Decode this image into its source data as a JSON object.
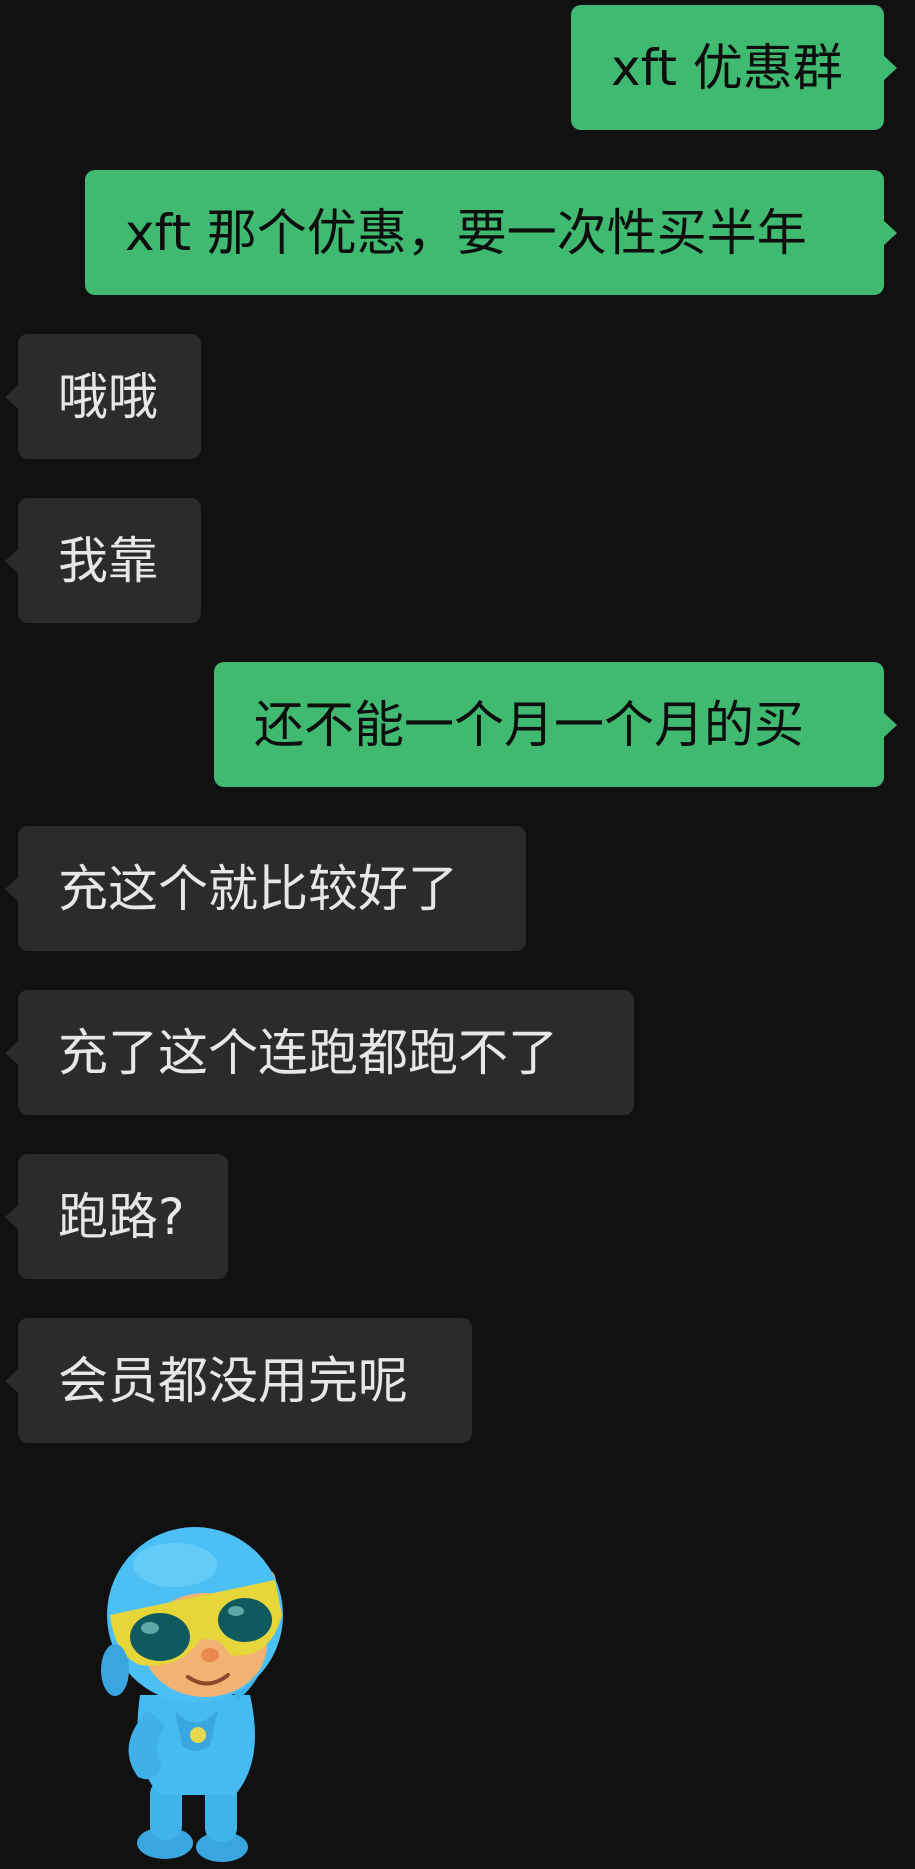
{
  "colors": {
    "background": "#111111",
    "outgoing_bubble": "#3fba70",
    "incoming_bubble": "#2b2b2b",
    "outgoing_text": "#0d0d0d",
    "incoming_text": "#e7e7e7"
  },
  "messages": [
    {
      "direction": "out",
      "text": "xft 优惠群"
    },
    {
      "direction": "out",
      "text": "xft 那个优惠，要一次性买半年"
    },
    {
      "direction": "in",
      "text": "哦哦"
    },
    {
      "direction": "in",
      "text": "我靠"
    },
    {
      "direction": "out",
      "text": "还不能一个月一个月的买"
    },
    {
      "direction": "in",
      "text": "充这个就比较好了"
    },
    {
      "direction": "in",
      "text": "充了这个连跑都跑不了"
    },
    {
      "direction": "in",
      "text": "跑路?"
    },
    {
      "direction": "in",
      "text": "会员都没用完呢"
    }
  ],
  "sticker": {
    "icon": "cartoon-character-sunglasses-sticker"
  }
}
